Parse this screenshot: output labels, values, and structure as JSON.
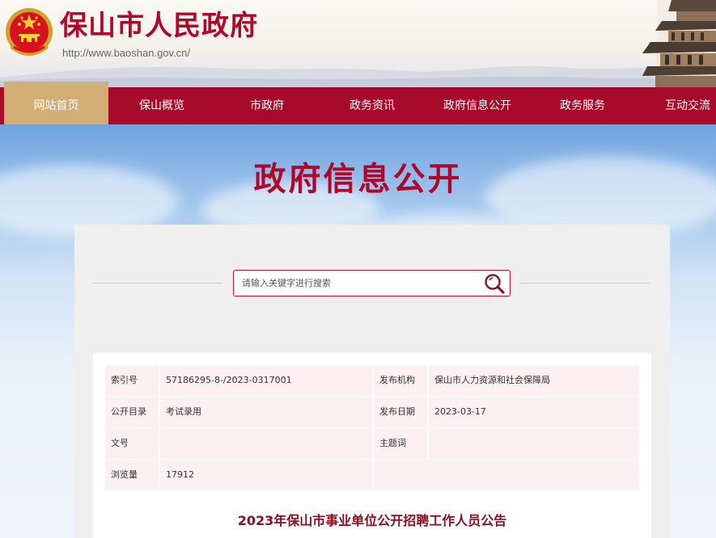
{
  "header": {
    "site_title": "保山市人民政府",
    "site_url": "http://www.baoshan.gov.cn/"
  },
  "nav": {
    "items": [
      {
        "label": "网站首页",
        "active": true
      },
      {
        "label": "保山概览",
        "active": false
      },
      {
        "label": "市政府",
        "active": false
      },
      {
        "label": "政务资讯",
        "active": false
      },
      {
        "label": "政府信息公开",
        "active": false
      },
      {
        "label": "政务服务",
        "active": false
      },
      {
        "label": "互动交流",
        "active": false
      }
    ]
  },
  "section_title": "政府信息公开",
  "search": {
    "placeholder": "请输入关键字进行搜索",
    "icon": "magnifier-icon"
  },
  "meta": {
    "index_label": "索引号",
    "index_value": "57186295-8-/2023-0317001",
    "publisher_label": "发布机构",
    "publisher_value": "保山市人力资源和社会保障局",
    "catalog_label": "公开目录",
    "catalog_value": "考试录用",
    "date_label": "发布日期",
    "date_value": "2023-03-17",
    "docno_label": "文号",
    "docno_value": "",
    "subject_label": "主题词",
    "subject_value": "",
    "views_label": "浏览量",
    "views_value": "17912"
  },
  "article": {
    "title": "2023年保山市事业单位公开招聘工作人员公告"
  },
  "colors": {
    "brand_red": "#a80a2b",
    "title_red": "#b0082a",
    "nav_active": "#d2ae76",
    "row_pink": "#fdf0f2"
  }
}
